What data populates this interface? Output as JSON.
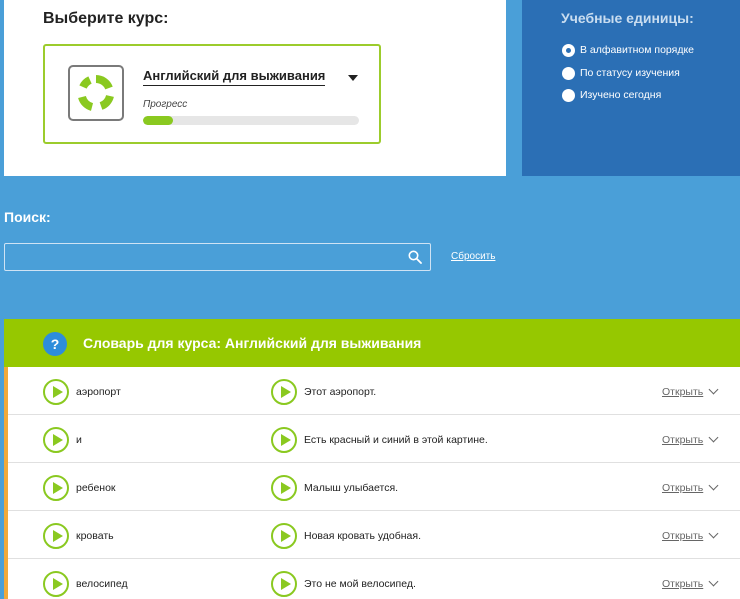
{
  "course": {
    "heading": "Выберите курс:",
    "name": "Английский для выживания",
    "progress_label": "Прогресс",
    "progress_value": 0.14
  },
  "units": {
    "heading": "Учебные единицы:",
    "options": [
      {
        "label": "В алфавитном порядке",
        "selected": true
      },
      {
        "label": "По статусу изучения",
        "selected": false
      },
      {
        "label": "Изучено сегодня",
        "selected": false
      }
    ]
  },
  "search": {
    "label": "Поиск:",
    "value": "",
    "reset_label": "Сбросить"
  },
  "vocabulary": {
    "help_glyph": "?",
    "title": "Словарь для курса: Английский для выживания",
    "open_label": "Открыть",
    "rows": [
      {
        "word": "аэропорт",
        "sentence": "Этот аэропорт."
      },
      {
        "word": "и",
        "sentence": "Есть красный и синий в этой картине."
      },
      {
        "word": "ребенок",
        "sentence": "Малыш улыбается."
      },
      {
        "word": "кровать",
        "sentence": "Новая кровать удобная."
      },
      {
        "word": "велосипед",
        "sentence": "Это не мой велосипед."
      }
    ]
  },
  "colors": {
    "accent_green": "#96c800",
    "panel_blue": "#2b6fb5",
    "background_blue": "#4a9fd8",
    "row_marker_orange": "#f1a93a"
  }
}
